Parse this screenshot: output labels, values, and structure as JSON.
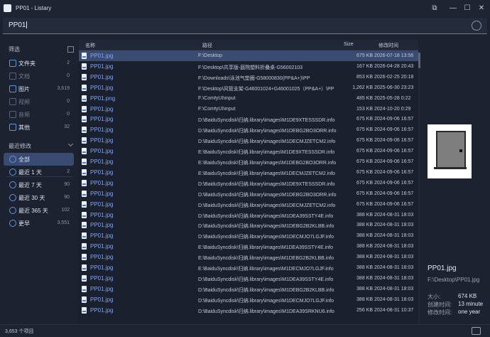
{
  "window": {
    "title": "PP01 - Listary"
  },
  "search": {
    "query": "PP01"
  },
  "sidebar": {
    "filter_header": "筛选",
    "types": [
      {
        "label": "文件夹",
        "count": "2",
        "icon": "folder-icon"
      },
      {
        "label": "文档",
        "count": "0",
        "icon": "document-icon"
      },
      {
        "label": "图片",
        "count": "3,619",
        "icon": "image-icon"
      },
      {
        "label": "视频",
        "count": "0",
        "icon": "video-icon"
      },
      {
        "label": "音频",
        "count": "0",
        "icon": "audio-icon"
      },
      {
        "label": "其他",
        "count": "32",
        "icon": "tag-icon"
      }
    ],
    "modified_header": "最近修改",
    "times": [
      {
        "label": "全部",
        "count": ""
      },
      {
        "label": "最近 1 天",
        "count": "2"
      },
      {
        "label": "最近 7 天",
        "count": "90"
      },
      {
        "label": "最近 30 天",
        "count": "90"
      },
      {
        "label": "最近 365 天",
        "count": "102"
      },
      {
        "label": "更早",
        "count": "3,551"
      }
    ]
  },
  "table": {
    "headers": {
      "name": "名称",
      "path": "路径",
      "size": "Size",
      "date": "修改时间"
    },
    "rows": [
      {
        "name": "PP01.jpg",
        "path": "F:\\Desktop",
        "size": "675 KB",
        "date": "2026-07-18 13:56"
      },
      {
        "name": "PP01.jpg",
        "path": "F:\\Desktop\\共享版-庭院塑料折叠桌-G56002103",
        "size": "167 KB",
        "date": "2026-04-28 20:43"
      },
      {
        "name": "PP01.jpg",
        "path": "F:\\Downloads\\泳池气垫圈-G58000830(PP&A+)\\PP",
        "size": "853 KB",
        "date": "2026-02-25 20:18"
      },
      {
        "name": "PP01.jpg",
        "path": "F:\\Desktop\\风管支架-G46001024+G46001025（PP&A+）\\PP",
        "size": "1,262 KB",
        "date": "2025-06-30 23:23"
      },
      {
        "name": "PP01.png",
        "path": "F:\\ComfyUI\\input",
        "size": "485 KB",
        "date": "2025-05-28 0:22"
      },
      {
        "name": "PP01.jpg",
        "path": "F:\\ComfyUI\\input",
        "size": "153 KB",
        "date": "2024-10-20 0:29"
      },
      {
        "name": "PP01.jpg",
        "path": "D:\\BaiduSyncdisk\\归纳.library\\images\\M1DE9XTESSSDR.info",
        "size": "675 KB",
        "date": "2024-09-06 16:57"
      },
      {
        "name": "PP01.jpg",
        "path": "D:\\BaiduSyncdisk\\归纳.library\\images\\M1DEBG2BO3ORR.info",
        "size": "675 KB",
        "date": "2024-09-06 16:57"
      },
      {
        "name": "PP01.jpg",
        "path": "D:\\BaiduSyncdisk\\归纳.library\\images\\M1DECMJZETCM2.info",
        "size": "675 KB",
        "date": "2024-09-06 16:57"
      },
      {
        "name": "PP01.jpg",
        "path": "E:\\BaiduSyncdisk\\归纳.library\\images\\M1DE9XTESSSDR.info",
        "size": "675 KB",
        "date": "2024-09-06 16:57"
      },
      {
        "name": "PP01.jpg",
        "path": "E:\\BaiduSyncdisk\\归纳.library\\images\\M1DEBG2BO3ORR.info",
        "size": "675 KB",
        "date": "2024-09-06 16:57"
      },
      {
        "name": "PP01.jpg",
        "path": "E:\\BaiduSyncdisk\\归纳.library\\images\\M1DECMJZETCM2.info",
        "size": "675 KB",
        "date": "2024-09-06 16:57"
      },
      {
        "name": "PP01.jpg",
        "path": "D:\\BaiduSyncdisk\\归纳.library\\images\\M1DE9XTESSSDR.info",
        "size": "675 KB",
        "date": "2024-09-06 16:57"
      },
      {
        "name": "PP01.jpg",
        "path": "D:\\BaiduSyncdisk\\归纳.library\\images\\M1DEBG2BO3ORR.info",
        "size": "675 KB",
        "date": "2024-09-06 16:57"
      },
      {
        "name": "PP01.jpg",
        "path": "D:\\BaiduSyncdisk\\归纳.library\\images\\M1DECMJZETCM2.info",
        "size": "675 KB",
        "date": "2024-09-06 16:57"
      },
      {
        "name": "PP01.jpg",
        "path": "D:\\BaiduSyncdisk\\归纳.library\\images\\M1DEA39SSTY4E.info",
        "size": "388 KB",
        "date": "2024-08-31 18:03"
      },
      {
        "name": "PP01.jpg",
        "path": "D:\\BaiduSyncdisk\\归纳.library\\images\\M1DEBG2B2KLBB.info",
        "size": "388 KB",
        "date": "2024-08-31 18:03"
      },
      {
        "name": "PP01.jpg",
        "path": "D:\\BaiduSyncdisk\\归纳.library\\images\\M1DECMJO7LGJF.info",
        "size": "388 KB",
        "date": "2024-08-31 18:03"
      },
      {
        "name": "PP01.jpg",
        "path": "E:\\BaiduSyncdisk\\归纳.library\\images\\M1DEA39SSTY4E.info",
        "size": "388 KB",
        "date": "2024-08-31 18:03"
      },
      {
        "name": "PP01.jpg",
        "path": "E:\\BaiduSyncdisk\\归纳.library\\images\\M1DEBG2B2KLBB.info",
        "size": "388 KB",
        "date": "2024-08-31 18:03"
      },
      {
        "name": "PP01.jpg",
        "path": "E:\\BaiduSyncdisk\\归纳.library\\images\\M1DECMJO7LGJF.info",
        "size": "388 KB",
        "date": "2024-08-31 18:03"
      },
      {
        "name": "PP01.jpg",
        "path": "D:\\BaiduSyncdisk\\归纳.library\\images\\M1DEA39SSTY4E.info",
        "size": "388 KB",
        "date": "2024-08-31 18:03"
      },
      {
        "name": "PP01.jpg",
        "path": "D:\\BaiduSyncdisk\\归纳.library\\images\\M1DEBG2B2KLBB.info",
        "size": "388 KB",
        "date": "2024-08-31 18:03"
      },
      {
        "name": "PP01.jpg",
        "path": "D:\\BaiduSyncdisk\\归纳.library\\images\\M1DECMJO7LGJF.info",
        "size": "388 KB",
        "date": "2024-08-31 18:03"
      },
      {
        "name": "PP01.jpg",
        "path": "D:\\BaiduSyncdisk\\归纳.library\\images\\M1DEA39SRKNU6.info",
        "size": "256 KB",
        "date": "2024-08-31 10:37"
      }
    ]
  },
  "preview": {
    "name": "PP01.jpg",
    "path": "F:\\Desktop\\PP01.jpg",
    "size_label": "大小:",
    "size_value": "674 KB",
    "created_label": "创建时间:",
    "created_value": "13 minute",
    "modified_label": "修改时间:",
    "modified_value": "one year"
  },
  "status": {
    "count": "3,653 个项目"
  }
}
